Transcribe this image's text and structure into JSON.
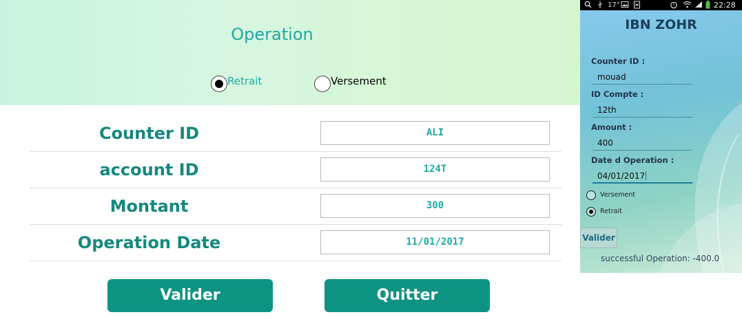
{
  "web": {
    "title": "Operation",
    "radio_options": [
      {
        "label": "Retrait",
        "selected": true
      },
      {
        "label": "Versement",
        "selected": false
      }
    ],
    "fields": [
      {
        "label": "Counter ID",
        "value": "ALI"
      },
      {
        "label": "account ID",
        "value": "124T"
      },
      {
        "label": "Montant",
        "value": "300"
      },
      {
        "label": "Operation Date",
        "value": "11/01/2017"
      }
    ],
    "buttons": {
      "submit_label": "Valider",
      "quit_label": "Quitter"
    },
    "colors": {
      "accent": "#14887e",
      "button": "#0e9383",
      "header_text": "#20a8a2"
    }
  },
  "phone": {
    "status_bar": {
      "left_icons": [
        "search-icon",
        "usb-icon",
        "image-icon",
        "file-icon"
      ],
      "temperature": "17°",
      "right_icons": [
        "alarm-icon",
        "wifi-icon",
        "signal-icon",
        "battery-icon"
      ],
      "time": "22:28"
    },
    "app_title": "IBN ZOHR",
    "fields": [
      {
        "label": "Counter ID :",
        "value": "mouad"
      },
      {
        "label": "ID Compte :",
        "value": "12th"
      },
      {
        "label": "Amount :",
        "value": "400"
      },
      {
        "label": "Date d Operation :",
        "value": "04/01/2017"
      }
    ],
    "radio_options": [
      {
        "label": "Versement",
        "selected": false
      },
      {
        "label": "Retrait",
        "selected": true
      }
    ],
    "submit_label": "Valider",
    "status_message": "successful Operation: -400.0"
  }
}
